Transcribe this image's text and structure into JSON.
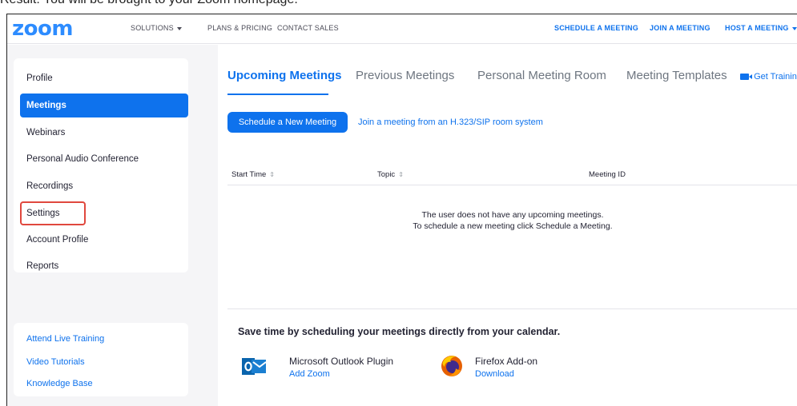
{
  "caption": "Result: You will be brought to your Zoom homepage.",
  "brand": {
    "logo": "zoom",
    "color": "#2D8CFF",
    "accent": "#0E72ED"
  },
  "topnav": {
    "solutions": "SOLUTIONS",
    "plans": "PLANS & PRICING",
    "contact": "CONTACT SALES",
    "schedule": "SCHEDULE A MEETING",
    "join": "JOIN A MEETING",
    "host": "HOST A MEETING"
  },
  "sidebar": {
    "items": [
      {
        "label": "Profile"
      },
      {
        "label": "Meetings",
        "active": true
      },
      {
        "label": "Webinars"
      },
      {
        "label": "Personal Audio Conference"
      },
      {
        "label": "Recordings"
      },
      {
        "label": "Settings",
        "highlighted": true
      },
      {
        "label": "Account Profile"
      },
      {
        "label": "Reports"
      }
    ],
    "help": [
      {
        "label": "Attend Live Training"
      },
      {
        "label": "Video Tutorials"
      },
      {
        "label": "Knowledge Base"
      }
    ]
  },
  "tabs": {
    "upcoming": "Upcoming Meetings",
    "previous": "Previous Meetings",
    "pmr": "Personal Meeting Room",
    "templates": "Meeting Templates",
    "training": "Get Trainin"
  },
  "actions": {
    "schedule_button": "Schedule a New Meeting",
    "sip_link": "Join a meeting from an H.323/SIP room system"
  },
  "table": {
    "columns": [
      "Start Time",
      "Topic",
      "Meeting ID"
    ],
    "empty_line1": "The user does not have any upcoming meetings.",
    "empty_line2": "To schedule a new meeting click Schedule a Meeting."
  },
  "promo": {
    "heading": "Save time by scheduling your meetings directly from your calendar.",
    "outlook": {
      "title": "Microsoft Outlook Plugin",
      "link": "Add Zoom",
      "icon": "outlook-icon"
    },
    "firefox": {
      "title": "Firefox Add-on",
      "link": "Download",
      "icon": "firefox-icon"
    }
  }
}
